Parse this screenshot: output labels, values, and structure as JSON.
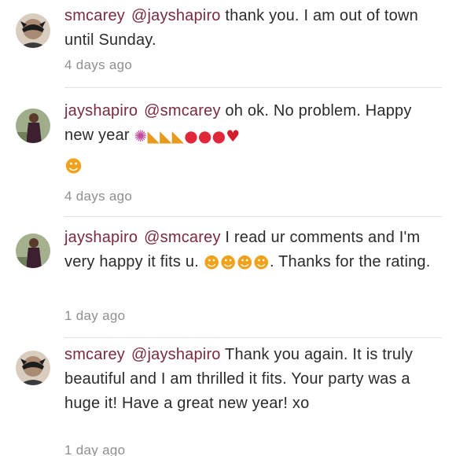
{
  "comments": [
    {
      "username": "smcarey",
      "mention": "@jayshapiro",
      "body": " thank you. I am out of town until Sunday.",
      "time": "4 days ago"
    },
    {
      "username": "jayshapiro",
      "mention": "@smcarey",
      "body": " oh ok. No problem. Happy new year ",
      "emojis": [
        "confetti-ball",
        "party-popper",
        "party-popper",
        "party-popper",
        "balloon",
        "balloon",
        "balloon",
        "red-heart",
        "face-blowing-kiss"
      ],
      "time": "4 days ago"
    },
    {
      "username": "jayshapiro",
      "mention": "@smcarey",
      "body_a": " I read ur comments and I'm very happy it fits u. ",
      "emojis": [
        "face-blowing-kiss",
        "face-blowing-kiss",
        "face-blowing-kiss",
        "face-blowing-kiss"
      ],
      "body_b": ". Thanks for the rating.",
      "time": "1 day ago"
    },
    {
      "username": "smcarey",
      "mention": "@jayshapiro",
      "body": " Thank you again.  It is truly beautiful and I am thrilled it fits.  Your party was a huge it!  Have a great new year! xo",
      "time": "1 day ago"
    }
  ],
  "colors": {
    "username": "#7a2a3e",
    "body": "#2b2b2b",
    "timestamp": "#8f8f8f",
    "divider": "#e3e3e3"
  }
}
